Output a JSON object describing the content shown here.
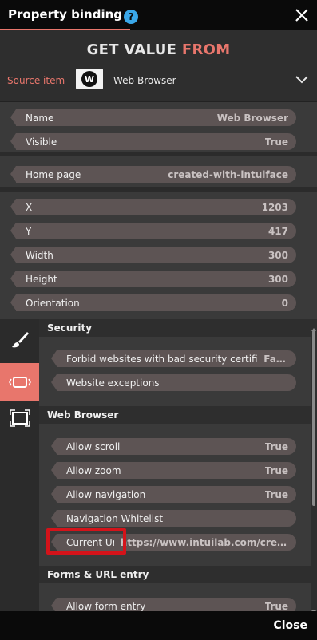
{
  "window": {
    "title": "Property binding",
    "help_icon": "question-icon",
    "close_icon": "close-icon",
    "help_glyph": "?"
  },
  "header": {
    "heading_part1": "GET VALUE",
    "heading_part2": "FROM",
    "source_label": "Source item",
    "source_logo_glyph": "W",
    "source_name": "Web Browser",
    "dropdown_icon": "chevron-down-icon"
  },
  "properties": [
    {
      "label": "Name",
      "value": "Web Browser"
    },
    {
      "label": "Visible",
      "value": "True"
    },
    {
      "label": "Home page",
      "value": "created-with-intuiface"
    },
    {
      "label": "X",
      "value": "1203"
    },
    {
      "label": "Y",
      "value": "417"
    },
    {
      "label": "Width",
      "value": "300"
    },
    {
      "label": "Height",
      "value": "300"
    },
    {
      "label": "Orientation",
      "value": "0"
    }
  ],
  "side_tabs": [
    {
      "name": "brush-icon"
    },
    {
      "name": "browser-icon",
      "active": true
    },
    {
      "name": "frame-icon"
    }
  ],
  "sections": {
    "security": {
      "title": "Security",
      "items": [
        {
          "label": "Forbid websites with bad security certificates",
          "value": "False"
        },
        {
          "label": "Website exceptions",
          "value": ""
        }
      ]
    },
    "web_browser": {
      "title": "Web Browser",
      "items": [
        {
          "label": "Allow scroll",
          "value": "True"
        },
        {
          "label": "Allow zoom",
          "value": "True"
        },
        {
          "label": "Allow navigation",
          "value": "True"
        },
        {
          "label": "Navigation Whitelist",
          "value": ""
        },
        {
          "label": "Current Url",
          "value": "https://www.intuilab.com/create..."
        }
      ]
    },
    "forms": {
      "title": "Forms & URL entry",
      "items": [
        {
          "label": "Allow form entry",
          "value": "True"
        }
      ]
    }
  },
  "colors": {
    "accent": "#e8766c",
    "pill": "#5d5454",
    "highlight": "#d4131a",
    "help": "#3aa7e8"
  },
  "footer": {
    "close_label": "Close"
  }
}
